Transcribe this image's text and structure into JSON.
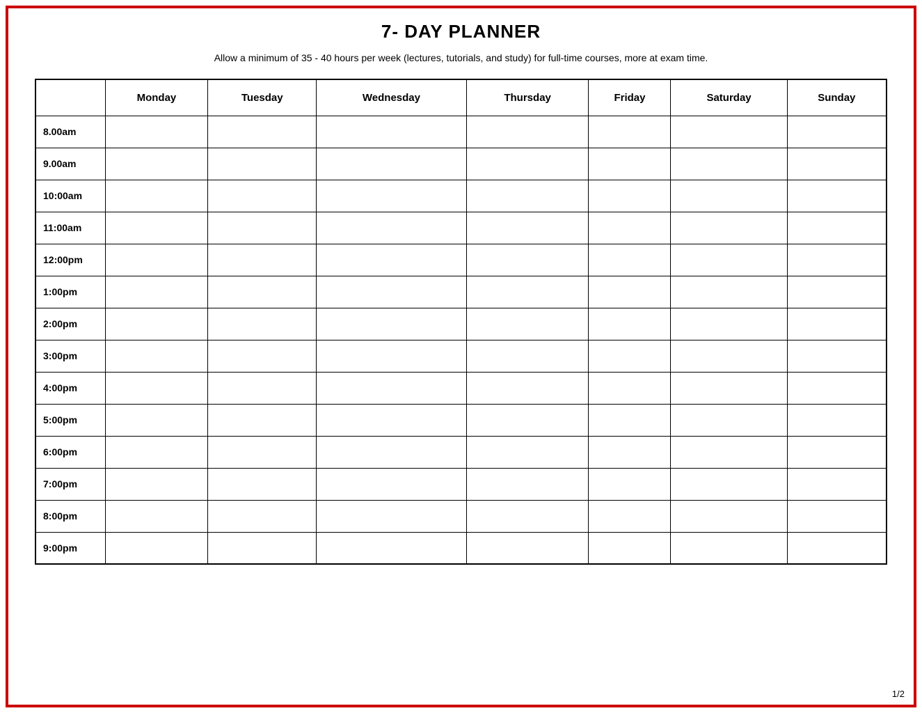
{
  "page": {
    "border_color": "#cc0000",
    "page_number": "1/2"
  },
  "header": {
    "title": "7- DAY PLANNER",
    "subtitle": "Allow a minimum of 35 - 40 hours per week (lectures, tutorials, and study) for full-time courses, more at exam time."
  },
  "table": {
    "columns": [
      "",
      "Monday",
      "Tuesday",
      "Wednesday",
      "Thursday",
      "Friday",
      "Saturday",
      "Sunday"
    ],
    "rows": [
      "8.00am",
      "9.00am",
      "10:00am",
      "11:00am",
      "12:00pm",
      "1:00pm",
      "2:00pm",
      "3:00pm",
      "4:00pm",
      "5:00pm",
      "6:00pm",
      "7:00pm",
      "8:00pm",
      "9:00pm"
    ]
  }
}
